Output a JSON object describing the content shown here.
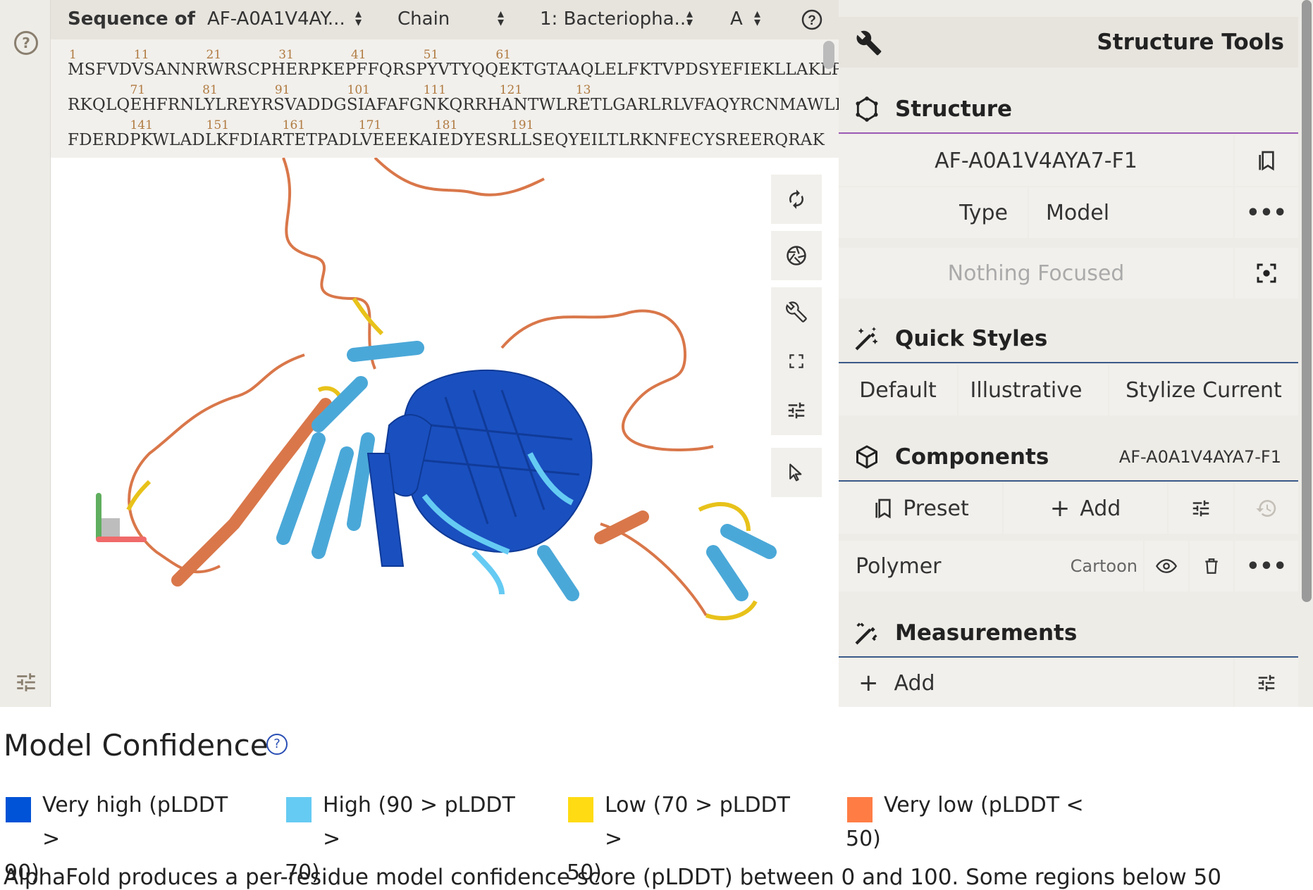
{
  "sequence_bar": {
    "label": "Sequence of",
    "entry": "AF-A0A1V4AY...",
    "mode": "Chain",
    "chain": "1: Bacteriopha...",
    "chain_id": "A"
  },
  "sequence": {
    "lines": [
      {
        "nums": "1               11               21               31               41               51               61",
        "text": "MSFVDVSANNRWRSCPHERPKEPFFQRSPYVTYQQEKTGTAAQLELFKTVPDSYEFIEKLLAKLP"
      },
      {
        "nums": "                71               81               91               101              111              121              13",
        "text": "RKQLQEHFRNLYLREYRSVADDGSIAFAFGNKQRRHANTWLRETLGARLRLVFAQYRCNMAWLLA"
      },
      {
        "nums": "                141              151              161              171              181              191",
        "text": "FDERDPKWLADLKFDIARTETPADLVEEEKAIEDYESRLLSEQYEILTLRKNFECYSREERQRAK"
      }
    ]
  },
  "panel": {
    "title": "Structure Tools",
    "structure": {
      "title": "Structure",
      "name": "AF-A0A1V4AYA7-F1",
      "type_label": "Type",
      "type_value": "Model",
      "focus": "Nothing Focused"
    },
    "quick_styles": {
      "title": "Quick Styles",
      "options": [
        "Default",
        "Illustrative",
        "Stylize Current"
      ]
    },
    "components": {
      "title": "Components",
      "entry": "AF-A0A1V4AYA7-F1",
      "preset": "Preset",
      "add": "Add",
      "polymer": "Polymer",
      "representation": "Cartoon"
    },
    "measurements": {
      "title": "Measurements",
      "add": "Add"
    }
  },
  "confidence": {
    "title": "Model Confidence",
    "legend": [
      {
        "line1": "Very high (pLDDT >",
        "line2": "90)",
        "color": "#0053d6"
      },
      {
        "line1": "High (90 > pLDDT >",
        "line2": "70)",
        "color": "#65cbf3"
      },
      {
        "line1": "Low (70 > pLDDT >",
        "line2": "50)",
        "color": "#ffdb13"
      },
      {
        "line1": "Very low (pLDDT <",
        "line2": "50)",
        "color": "#ff7d45"
      }
    ],
    "description": "AlphaFold produces a per-residue model confidence score (pLDDT) between 0 and 100. Some regions below 50"
  }
}
